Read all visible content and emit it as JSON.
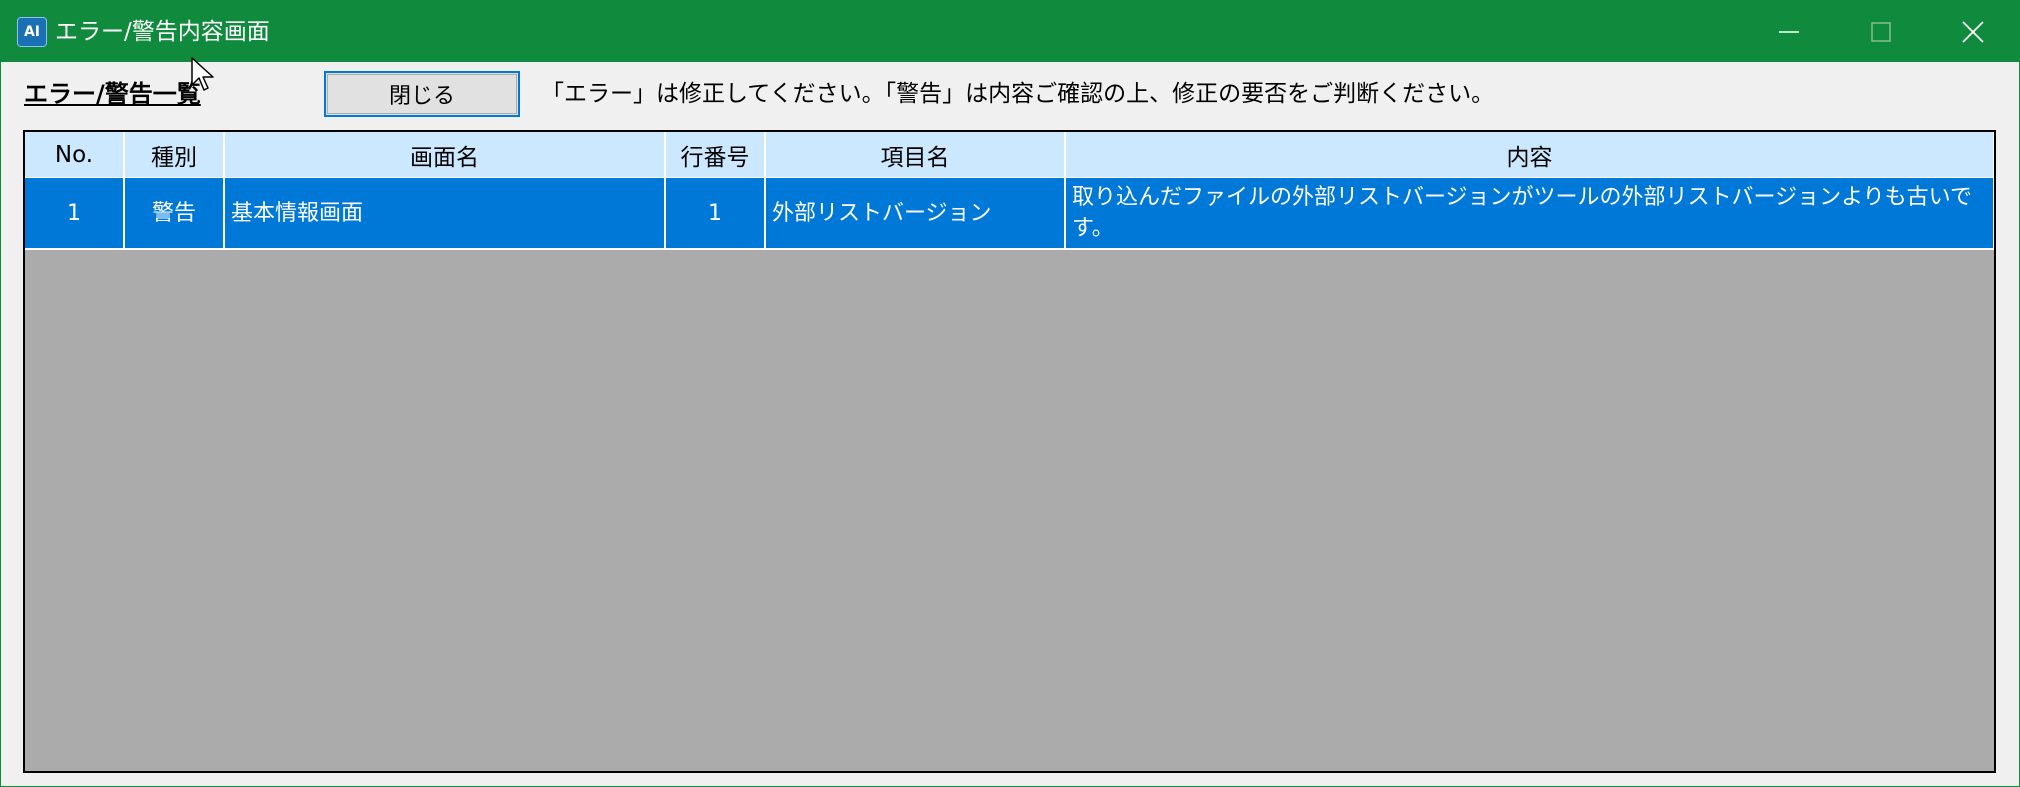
{
  "window": {
    "title": "エラー/警告内容画面",
    "app_icon_text": "AI",
    "titlebar_color": "#108a3c"
  },
  "toolbar": {
    "section_title": "エラー/警告一覧",
    "close_button_label": "閉じる",
    "instruction": "「エラー」は修正してください。「警告」は内容ご確認の上、修正の要否をご判断ください。"
  },
  "table": {
    "headers": [
      "No.",
      "種別",
      "画面名",
      "行番号",
      "項目名",
      "内容"
    ],
    "rows": [
      {
        "no": "1",
        "type": "警告",
        "screen_name": "基本情報画面",
        "line_no": "1",
        "item_name": "外部リストバージョン",
        "content": "取り込んだファイルの外部リストバージョンがツールの外部リストバージョンよりも古いです。"
      }
    ],
    "header_bg": "#cce8ff",
    "selected_row_bg": "#0078d7",
    "empty_area_bg": "#ababab"
  },
  "icons": {
    "minimize": "minimize-icon",
    "maximize": "maximize-icon",
    "close": "close-icon",
    "cursor": "mouse-pointer-icon"
  }
}
